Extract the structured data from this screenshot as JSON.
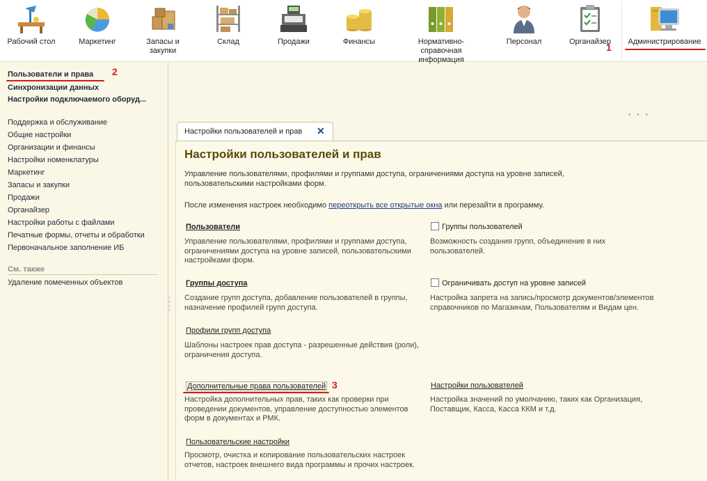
{
  "toolbar": {
    "items": [
      {
        "label": "Рабочий стол",
        "icon": "desk-icon"
      },
      {
        "label": "Маркетинг",
        "icon": "pie-chart-icon"
      },
      {
        "label": "Запасы и закупки",
        "icon": "boxes-icon"
      },
      {
        "label": "Склад",
        "icon": "warehouse-shelf-icon"
      },
      {
        "label": "Продажи",
        "icon": "cash-register-icon"
      },
      {
        "label": "Финансы",
        "icon": "coins-icon"
      },
      {
        "label": "Нормативно-справочная информация",
        "icon": "binders-icon"
      },
      {
        "label": "Персонал",
        "icon": "person-icon"
      },
      {
        "label": "Органайзер",
        "icon": "clipboard-icon"
      },
      {
        "label": "Администрирование",
        "icon": "computer-icon"
      }
    ]
  },
  "annotations": {
    "n1": "1",
    "n2": "2",
    "n3": "3"
  },
  "sidebar": {
    "primary": [
      "Пользователи и права",
      "Синхронизации данных",
      "Настройки подключаемого оборуд..."
    ],
    "items": [
      "Поддержка и обслуживание",
      "Общие настройки",
      "Организации и финансы",
      "Настройки номенклатуры",
      "Маркетинг",
      "Запасы и закупки",
      "Продажи",
      "Органайзер",
      "Настройки работы с файлами",
      "Печатные формы, отчеты и обработки",
      "Первоначальное заполнение ИБ"
    ],
    "see_also_caption": "См. также",
    "see_also_items": [
      "Удаление помеченных объектов"
    ]
  },
  "tab": {
    "title": "Настройки пользователей и прав",
    "close": "✕"
  },
  "content": {
    "title": "Настройки пользователей и прав",
    "intro_line1": "Управление пользователями, профилями и группами доступа, ограничениями доступа на уровне записей,",
    "intro_line2": "пользовательскими настройками форм.",
    "note_before": "После изменения настроек необходимо ",
    "note_link": "переоткрыть все открытые окна",
    "note_after": " или перезайти в программу.",
    "left_sections": [
      {
        "link": "Пользователи",
        "desc": [
          "Управление пользователями, профилями и группами доступа,",
          "ограничениями доступа на уровне записей, пользовательскими",
          "настройками форм."
        ]
      },
      {
        "link": "Группы доступа",
        "desc": [
          "Создание групп доступа, добавление пользователей в группы,",
          "назначение профилей групп доступа."
        ]
      },
      {
        "link": "Профили групп доступа",
        "desc": [
          "Шаблоны настроек прав доступа - разрешенные действия (роли),",
          "ограничения доступа."
        ]
      },
      {
        "link": "Дополнительные права пользователей",
        "desc": [
          "Настройка дополнительных прав, таких как проверки при",
          "проведении документов, управление доступностью элементов",
          "форм в документах и РМК."
        ]
      },
      {
        "link": "Пользовательские настройки",
        "desc": [
          "Просмотр, очистка и копирование пользовательских настроек",
          "отчетов, настроек внешнего вида программы и прочих настроек."
        ]
      }
    ],
    "right_sections": [
      {
        "checkbox": "Группы пользователей",
        "checked": false,
        "desc": [
          "Возможность создания групп, объединение в них",
          "пользователей."
        ]
      },
      {
        "checkbox": "Ограничивать доступ на уровне записей",
        "checked": false,
        "desc": [
          "Настройка запрета на запись/просмотр документов/элементов",
          "справочников по Магазинам, Пользователям и Видам цен."
        ]
      },
      {
        "link": "Настройки пользователей",
        "desc": [
          "Настройка значений по умолчанию, таких как Организация,",
          "Поставщик, Касса, Касса ККМ и т.д."
        ]
      }
    ]
  }
}
